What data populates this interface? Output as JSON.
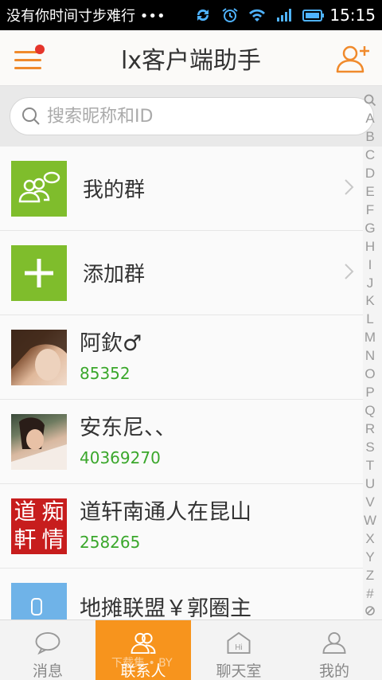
{
  "status_bar": {
    "notification": "没有你时间寸步难行 •••",
    "time": "15:15",
    "icons": [
      "sync-icon",
      "alarm-icon",
      "wifi-icon",
      "signal-icon",
      "battery-icon"
    ]
  },
  "header": {
    "title": "lx客户端助手",
    "menu_icon": "menu-icon",
    "add_contact_icon": "add-user-icon",
    "accent_color": "#f08a2c",
    "badge_color": "#e5352b"
  },
  "search": {
    "placeholder": "搜索昵称和ID"
  },
  "groups": [
    {
      "label": "我的群",
      "icon": "group-chat-icon"
    },
    {
      "label": "添加群",
      "icon": "plus-icon"
    }
  ],
  "contacts": [
    {
      "name": "阿欽♂",
      "id": "85352"
    },
    {
      "name": "安东尼、、",
      "id": "40369270"
    },
    {
      "name": "道轩南通人在昆山",
      "id": "258265",
      "avatar_text": [
        "道",
        "痴",
        "軒",
        "情"
      ]
    },
    {
      "name": "地摊联盟￥郭圈主",
      "id": ""
    }
  ],
  "index_letters": [
    "A",
    "B",
    "C",
    "D",
    "E",
    "F",
    "G",
    "H",
    "I",
    "J",
    "K",
    "L",
    "M",
    "N",
    "O",
    "P",
    "Q",
    "R",
    "S",
    "T",
    "U",
    "V",
    "W",
    "X",
    "Y",
    "Z",
    "#"
  ],
  "tabs": [
    {
      "label": "消息",
      "icon": "message-icon",
      "active": false
    },
    {
      "label": "联系人",
      "icon": "contacts-icon",
      "active": true
    },
    {
      "label": "聊天室",
      "icon": "chatroom-icon",
      "active": false
    },
    {
      "label": "我的",
      "icon": "profile-icon",
      "active": false
    }
  ],
  "watermark": "下载集 • BY",
  "colors": {
    "group_green": "#7fbd2c",
    "id_green": "#3aa72b",
    "active_tab": "#f7941d"
  }
}
